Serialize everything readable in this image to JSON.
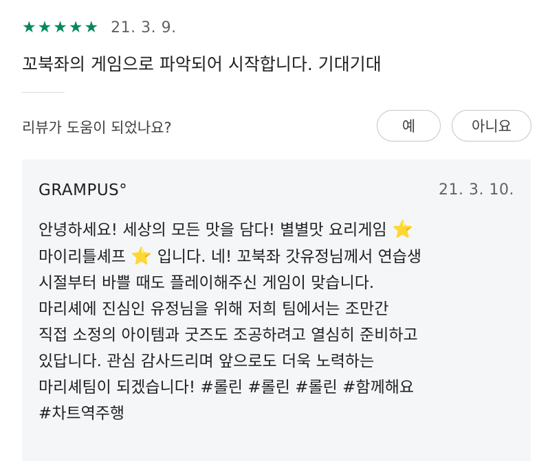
{
  "review": {
    "rating": 5,
    "rating_max": 5,
    "star_glyph": "★",
    "star_color": "#01875f",
    "date": "21. 3. 9.",
    "text": "꼬북좌의 게임으로 파악되어 시작합니다. 기대기대"
  },
  "helpful": {
    "question": "리뷰가 도움이 되었나요?",
    "yes_label": "예",
    "no_label": "아니요"
  },
  "reply": {
    "developer_name": "GRAMPUS°",
    "date": "21. 3. 10.",
    "star_emoji": "⭐",
    "lines": [
      {
        "before": "안녕하세요! 세상의 모든 맛을 담다! 별별맛 요리게임 ",
        "after": ""
      },
      {
        "before": "마이리틀셰프 ",
        "after": " 입니다. 네! 꼬북좌 갓유정님께서 연습생"
      },
      {
        "text": "시절부터 바쁠 때도 플레이해주신 게임이 맞습니다."
      },
      {
        "text": "마리셰에 진심인 유정님을 위해 저희 팀에서는 조만간"
      },
      {
        "text": "직접 소정의 아이템과 굿즈도 조공하려고 열심히 준비하고"
      },
      {
        "text": "있답니다. 관심 감사드리며 앞으로도 더욱 노력하는"
      },
      {
        "text": "마리셰팀이 되겠습니다! #롤린 #롤린 #롤린 #함께해요"
      },
      {
        "text": "#차트역주행"
      }
    ]
  }
}
